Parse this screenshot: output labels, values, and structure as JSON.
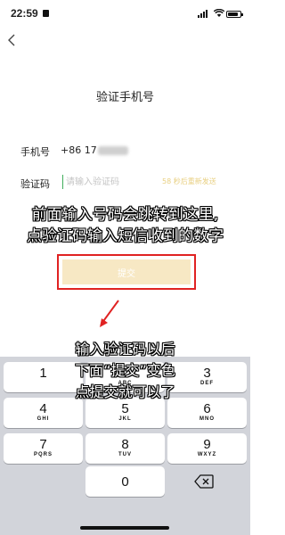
{
  "status_bar": {
    "time": "22:59"
  },
  "page": {
    "title": "验证手机号"
  },
  "form": {
    "phone_label": "手机号",
    "phone_value": "+86 17",
    "code_label": "验证码",
    "code_placeholder": "请输入验证码",
    "code_value": "",
    "resend_text": "58 秒后重新发送",
    "submit_label": "提交"
  },
  "annotations": {
    "line1": "前面输入号码会跳转到这里,",
    "line2": "点验证码输入短信收到的数字",
    "line3": "输入验证码以后",
    "line4": "下面“提交”变色",
    "line5": "点提交就可以了"
  },
  "keyboard": {
    "keys": [
      {
        "num": "1",
        "letters": ""
      },
      {
        "num": "2",
        "letters": "ABC"
      },
      {
        "num": "3",
        "letters": "DEF"
      },
      {
        "num": "4",
        "letters": "GHI"
      },
      {
        "num": "5",
        "letters": "JKL"
      },
      {
        "num": "6",
        "letters": "MNO"
      },
      {
        "num": "7",
        "letters": "PQRS"
      },
      {
        "num": "8",
        "letters": "TUV"
      },
      {
        "num": "9",
        "letters": "WXYZ"
      },
      {
        "num": "0",
        "letters": ""
      }
    ]
  },
  "colors": {
    "annotation_box": "#e02222",
    "submit_disabled": "#f7e8c4",
    "cursor": "#3fae5a",
    "resend": "#e8cf80"
  },
  "icons": [
    "back-chevron-icon",
    "signal-icon",
    "wifi-icon",
    "battery-icon",
    "lock-icon",
    "backspace-icon",
    "arrow-annotation-icon"
  ]
}
